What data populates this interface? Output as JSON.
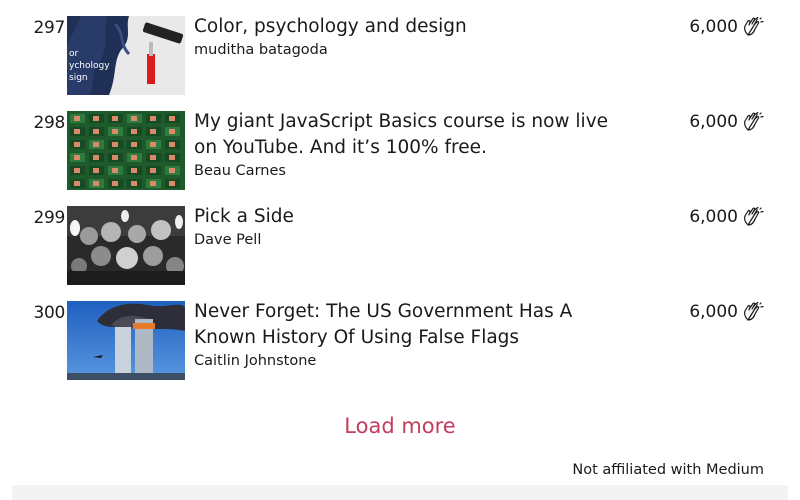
{
  "articles": [
    {
      "rank": "297",
      "title": "Color, psychology and design",
      "author": "muditha batagoda",
      "claps": "6,000",
      "thumbnail_icon": "color-psychology-thumbnail",
      "thumbnail_text": "or\nychology\nsign"
    },
    {
      "rank": "298",
      "title": "My giant JavaScript Basics course is now live on YouTube. And it’s 100% free.",
      "author": "Beau Carnes",
      "claps": "6,000",
      "thumbnail_icon": "video-grid-thumbnail"
    },
    {
      "rank": "299",
      "title": "Pick a Side",
      "author": "Dave Pell",
      "claps": "6,000",
      "thumbnail_icon": "torch-crowd-thumbnail"
    },
    {
      "rank": "300",
      "title": "Never Forget: The US Government Has A Known History Of Using False Flags",
      "author": "Caitlin Johnstone",
      "claps": "6,000",
      "thumbnail_icon": "twin-towers-thumbnail"
    }
  ],
  "clap_icon": "clapping-hands-icon",
  "load_more_label": "Load more",
  "footer_note": "Not affiliated with Medium",
  "colors": {
    "accent": "#c43d5d",
    "text": "#1a1a1a"
  }
}
